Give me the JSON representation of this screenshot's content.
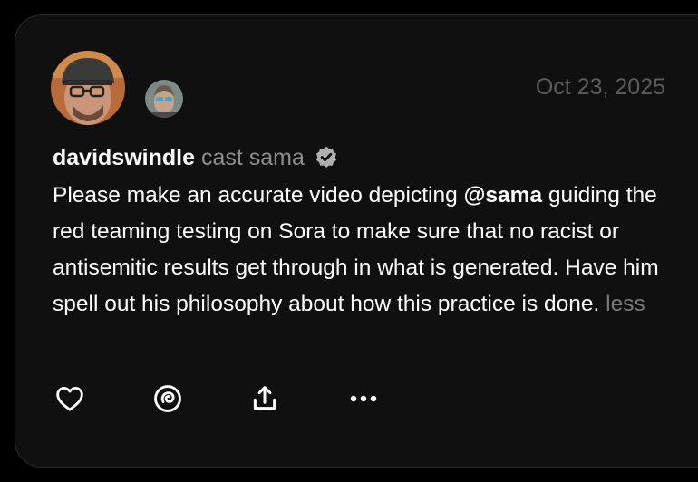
{
  "post": {
    "date": "Oct 23, 2025",
    "username": "davidswindle",
    "cast_text": "cast sama",
    "body_before": "Please make an accurate video depicting ",
    "mention": "@sama",
    "body_after": " guiding the red teaming testing on Sora to make sure that no racist or antisemitic results get through in what is generated. Have him spell out his philosophy about how this practice is done. ",
    "less_label": "less"
  },
  "icons": {
    "verified": "verified-badge-icon",
    "like": "heart-icon",
    "remix": "remix-icon",
    "share": "share-icon",
    "more": "more-icon"
  },
  "colors": {
    "card_bg": "#101010",
    "date": "#5c5c5c",
    "secondary_text": "#8e8e8e",
    "less": "#7a7a7a"
  }
}
